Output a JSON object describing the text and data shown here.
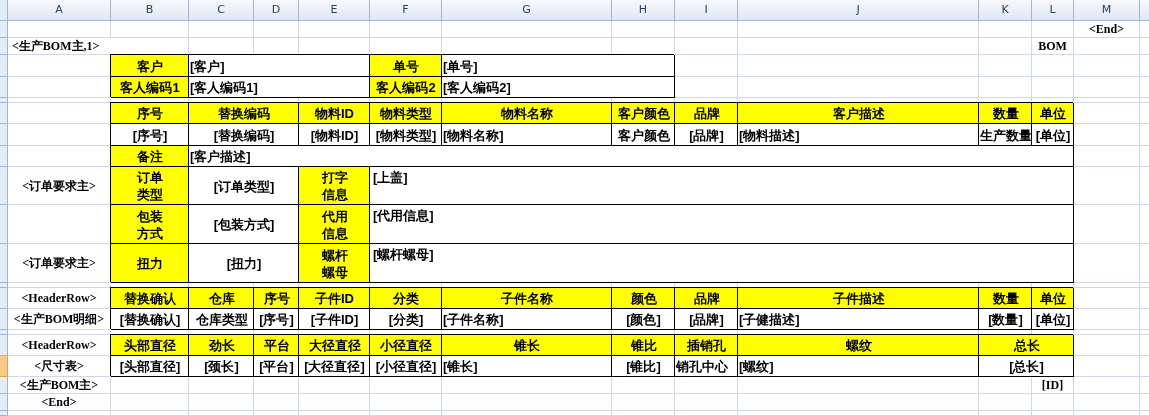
{
  "columns": [
    "A",
    "B",
    "C",
    "D",
    "E",
    "F",
    "G",
    "H",
    "I",
    "J",
    "K",
    "L",
    "M"
  ],
  "rows": [
    {
      "selected": false,
      "cells": [
        {
          "kind": "blank"
        },
        {
          "kind": "blank"
        },
        {
          "kind": "blank"
        },
        {
          "kind": "blank"
        },
        {
          "kind": "blank"
        },
        {
          "kind": "blank"
        },
        {
          "kind": "blank"
        },
        {
          "kind": "blank"
        },
        {
          "kind": "blank"
        },
        {
          "kind": "blank"
        },
        {
          "kind": "blank"
        },
        {
          "kind": "blank"
        },
        {
          "kind": "tag",
          "text": "<End>"
        }
      ]
    },
    {
      "selected": false,
      "cells": [
        {
          "kind": "tag_left",
          "text": "<生产BOM主,1>"
        },
        {
          "kind": "merged"
        },
        {
          "kind": "blank"
        },
        {
          "kind": "blank"
        },
        {
          "kind": "blank"
        },
        {
          "kind": "blank"
        },
        {
          "kind": "blank"
        },
        {
          "kind": "blank"
        },
        {
          "kind": "blank"
        },
        {
          "kind": "blank"
        },
        {
          "kind": "blank"
        },
        {
          "kind": "tag",
          "text": "BOM"
        }
      ]
    },
    {
      "selected": false,
      "cells": [
        {
          "kind": "blank"
        },
        {
          "kind": "label",
          "text": "客户"
        },
        {
          "kind": "field_left",
          "text": "[客户]"
        },
        {
          "kind": "merged"
        },
        {
          "kind": "merged"
        },
        {
          "kind": "label",
          "text": "单号"
        },
        {
          "kind": "field_left",
          "text": "[单号]"
        },
        {
          "kind": "merged"
        }
      ]
    },
    {
      "selected": false,
      "cells": [
        {
          "kind": "blank"
        },
        {
          "kind": "label",
          "text": "客人编码1"
        },
        {
          "kind": "field_left",
          "text": "[客人编码1]"
        },
        {
          "kind": "merged"
        },
        {
          "kind": "merged"
        },
        {
          "kind": "label",
          "text": "客人编码2"
        },
        {
          "kind": "field_left",
          "text": "[客人编码2]"
        },
        {
          "kind": "merged"
        }
      ]
    },
    {
      "selected": false
    },
    {
      "selected": false,
      "cells": [
        {
          "kind": "blank"
        },
        {
          "kind": "label",
          "text": "序号"
        },
        {
          "kind": "label",
          "text": "替换编码"
        },
        {
          "kind": "merged"
        },
        {
          "kind": "label",
          "text": "物料ID"
        },
        {
          "kind": "label",
          "text": "物料类型"
        },
        {
          "kind": "label",
          "text": "物料名称"
        },
        {
          "kind": "label",
          "text": "客户颜色"
        },
        {
          "kind": "label",
          "text": "品牌"
        },
        {
          "kind": "label",
          "text": "客户描述"
        },
        {
          "kind": "label",
          "text": "数量"
        },
        {
          "kind": "label",
          "text": "单位"
        }
      ]
    },
    {
      "selected": false,
      "cells": [
        {
          "kind": "blank"
        },
        {
          "kind": "field",
          "text": "[序号]"
        },
        {
          "kind": "field",
          "text": "[替换编码]"
        },
        {
          "kind": "merged"
        },
        {
          "kind": "field",
          "text": "[物料ID]"
        },
        {
          "kind": "field",
          "text": "[物料类型]"
        },
        {
          "kind": "field_left",
          "text": "[物料名称]"
        },
        {
          "kind": "field",
          "text": "客户颜色"
        },
        {
          "kind": "field",
          "text": "[品牌]"
        },
        {
          "kind": "field_left",
          "text": "[物料描述]"
        },
        {
          "kind": "field",
          "text": "生产数量"
        },
        {
          "kind": "field",
          "text": "[单位]"
        }
      ]
    },
    {
      "selected": false,
      "cells": [
        {
          "kind": "blank"
        },
        {
          "kind": "label",
          "text": "备注"
        },
        {
          "kind": "field_left",
          "text": "[客户描述]"
        },
        {
          "kind": "merged"
        },
        {
          "kind": "merged"
        },
        {
          "kind": "merged"
        },
        {
          "kind": "merged"
        },
        {
          "kind": "merged"
        },
        {
          "kind": "merged"
        },
        {
          "kind": "merged"
        },
        {
          "kind": "merged"
        },
        {
          "kind": "merged"
        }
      ]
    },
    {
      "selected": false,
      "cells": [
        {
          "kind": "tag",
          "text": "<订单要求主>"
        },
        {
          "kind": "label_wrap",
          "text": "订单类型"
        },
        {
          "kind": "field",
          "text": "[订单类型]"
        },
        {
          "kind": "merged"
        },
        {
          "kind": "label_wrap",
          "text": "打字信息"
        },
        {
          "kind": "field_top",
          "text": "[上盖]"
        },
        {
          "kind": "merged"
        },
        {
          "kind": "merged"
        },
        {
          "kind": "merged"
        },
        {
          "kind": "merged"
        },
        {
          "kind": "merged"
        },
        {
          "kind": "merged"
        }
      ]
    },
    {
      "selected": false,
      "cells": [
        {
          "kind": "blank"
        },
        {
          "kind": "label_wrap",
          "text": "包装方式"
        },
        {
          "kind": "field",
          "text": "[包装方式]"
        },
        {
          "kind": "merged"
        },
        {
          "kind": "label_wrap",
          "text": "代用信息"
        },
        {
          "kind": "field_top",
          "text": "[代用信息]"
        },
        {
          "kind": "merged"
        },
        {
          "kind": "merged"
        },
        {
          "kind": "merged"
        },
        {
          "kind": "merged"
        },
        {
          "kind": "merged"
        },
        {
          "kind": "merged"
        }
      ]
    },
    {
      "selected": false,
      "cells": [
        {
          "kind": "tag",
          "text": "<订单要求主>"
        },
        {
          "kind": "label",
          "text": "扭力"
        },
        {
          "kind": "field",
          "text": "[扭力]"
        },
        {
          "kind": "merged"
        },
        {
          "kind": "label_wrap",
          "text": "螺杆螺母"
        },
        {
          "kind": "field_top",
          "text": "[螺杆螺母]"
        },
        {
          "kind": "merged"
        },
        {
          "kind": "merged"
        },
        {
          "kind": "merged"
        },
        {
          "kind": "merged"
        },
        {
          "kind": "merged"
        },
        {
          "kind": "merged"
        }
      ]
    },
    {
      "selected": false
    },
    {
      "selected": false,
      "cells": [
        {
          "kind": "tag",
          "text": "<HeaderRow>"
        },
        {
          "kind": "label",
          "text": "替换确认"
        },
        {
          "kind": "label",
          "text": "仓库"
        },
        {
          "kind": "label",
          "text": "序号"
        },
        {
          "kind": "label",
          "text": "子件ID"
        },
        {
          "kind": "label",
          "text": "分类"
        },
        {
          "kind": "label",
          "text": "子件名称"
        },
        {
          "kind": "label",
          "text": "颜色"
        },
        {
          "kind": "label",
          "text": "品牌"
        },
        {
          "kind": "label",
          "text": "子件描述"
        },
        {
          "kind": "label",
          "text": "数量"
        },
        {
          "kind": "label",
          "text": "单位"
        }
      ]
    },
    {
      "selected": false,
      "cells": [
        {
          "kind": "tag",
          "text": "<生产BOM明细>"
        },
        {
          "kind": "field",
          "text": "[替换确认]"
        },
        {
          "kind": "field",
          "text": "仓库类型"
        },
        {
          "kind": "field",
          "text": "[序号]"
        },
        {
          "kind": "field",
          "text": "[子件ID]"
        },
        {
          "kind": "field",
          "text": "[分类]"
        },
        {
          "kind": "field_left",
          "text": "[子件名称]"
        },
        {
          "kind": "field",
          "text": "[颜色]"
        },
        {
          "kind": "field",
          "text": "[品牌]"
        },
        {
          "kind": "field_left",
          "text": "[子健描述]"
        },
        {
          "kind": "field",
          "text": "[数量]"
        },
        {
          "kind": "field",
          "text": "[单位]"
        }
      ]
    },
    {
      "selected": false
    },
    {
      "selected": false,
      "cells": [
        {
          "kind": "tag",
          "text": "<HeaderRow>"
        },
        {
          "kind": "label",
          "text": "头部直径"
        },
        {
          "kind": "label",
          "text": "劲长"
        },
        {
          "kind": "label",
          "text": "平台"
        },
        {
          "kind": "label",
          "text": "大径直径"
        },
        {
          "kind": "label",
          "text": "小径直径"
        },
        {
          "kind": "label",
          "text": "锥长"
        },
        {
          "kind": "label",
          "text": "锥比"
        },
        {
          "kind": "label",
          "text": "插销孔"
        },
        {
          "kind": "label",
          "text": "螺纹"
        },
        {
          "kind": "label",
          "text": "总长"
        },
        {
          "kind": "merged"
        }
      ]
    },
    {
      "selected": true,
      "cells": [
        {
          "kind": "tag",
          "text": "<尺寸表>"
        },
        {
          "kind": "field",
          "text": "[头部直径]"
        },
        {
          "kind": "field",
          "text": "[颈长]"
        },
        {
          "kind": "field",
          "text": "[平台]"
        },
        {
          "kind": "field",
          "text": "[大径直径]"
        },
        {
          "kind": "field",
          "text": "[小径直径]"
        },
        {
          "kind": "field_left",
          "text": "[锥长]"
        },
        {
          "kind": "field",
          "text": "[锥比]"
        },
        {
          "kind": "field_left",
          "text": "销孔中心"
        },
        {
          "kind": "field_left",
          "text": "[螺纹]"
        },
        {
          "kind": "field",
          "text": "[总长]"
        },
        {
          "kind": "merged"
        }
      ]
    },
    {
      "selected": false,
      "cells": [
        {
          "kind": "tag",
          "text": "<生产BOM主>"
        },
        {
          "kind": "blank"
        },
        {
          "kind": "blank"
        },
        {
          "kind": "blank"
        },
        {
          "kind": "blank"
        },
        {
          "kind": "blank"
        },
        {
          "kind": "blank"
        },
        {
          "kind": "blank"
        },
        {
          "kind": "blank"
        },
        {
          "kind": "blank"
        },
        {
          "kind": "blank"
        },
        {
          "kind": "tag",
          "text": "[ID]"
        }
      ]
    },
    {
      "selected": false,
      "cells": [
        {
          "kind": "tag",
          "text": "<End>"
        }
      ]
    },
    {
      "selected": false
    }
  ]
}
